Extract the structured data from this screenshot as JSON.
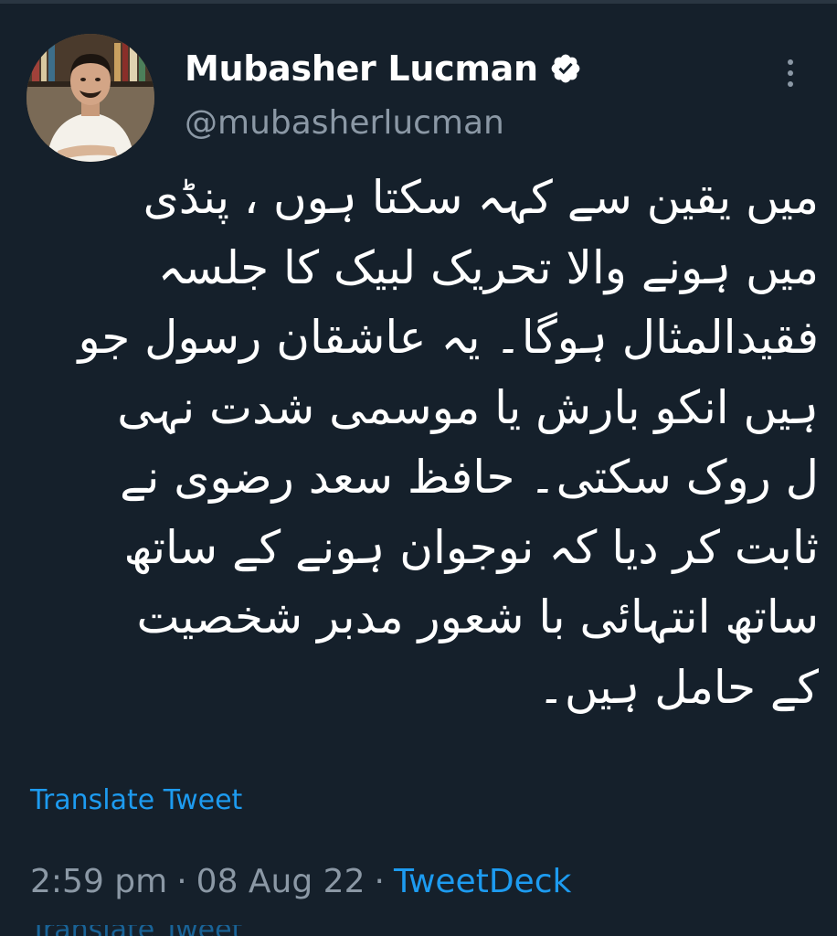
{
  "author": {
    "display_name": "Mubasher Lucman",
    "handle": "@mubasherlucman",
    "verified": true,
    "avatar_icon": "profile-photo"
  },
  "tweet": {
    "lines": [
      "میں یقین سے کہہ سکتا ہوں ، پنڈی",
      "میں ہونے والا تحریک لبیک کا جلسہ",
      "فقیدالمثال ہوگا۔ یہ عاشقان رسول جو",
      "ہیں انکو بارش یا موسمی شدت نہی",
      "ل روک سکتی۔ حافظ سعد رضوی نے",
      "ثابت کر دیا کہ نوجوان ہونے کے ساتھ",
      "ساتھ انتہائی با شعور مدبر شخصیت",
      "کے حامل ہیں۔"
    ],
    "translate_label": "Translate Tweet"
  },
  "meta": {
    "time": "2:59 pm",
    "separator": "·",
    "date": "08 Aug 22",
    "source": "TweetDeck"
  },
  "colors": {
    "background": "#15202b",
    "text": "#ffffff",
    "muted": "#8b98a5",
    "accent": "#1d9bf0"
  },
  "icons": {
    "verified": "verified-badge-icon",
    "more": "more-vertical-icon"
  }
}
